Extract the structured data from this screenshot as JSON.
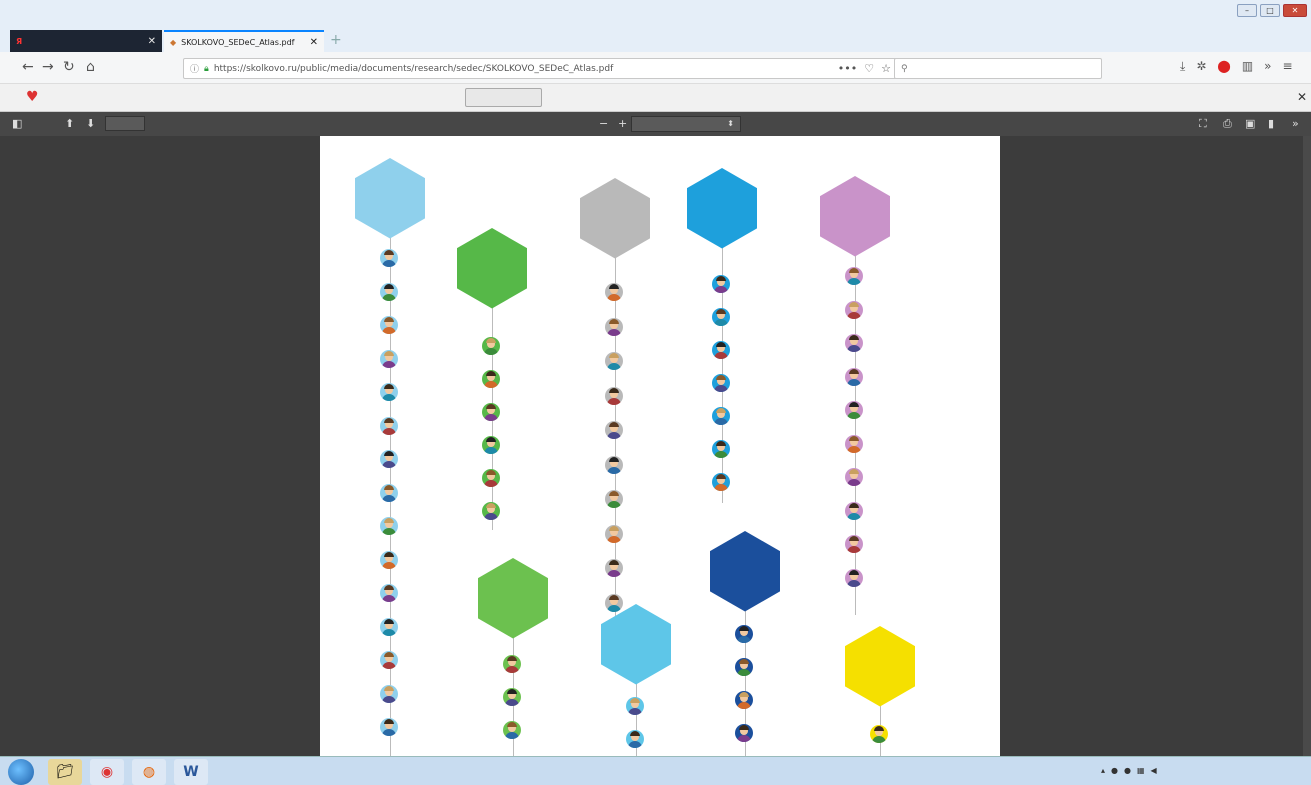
{
  "titlebar": {
    "menu": [
      "",
      "",
      "",
      "",
      "",
      "",
      ""
    ]
  },
  "tabs": [
    {
      "title": "",
      "active": false
    },
    {
      "title": "SKOLKOVO_SEDeC_Atlas.pdf",
      "active": true
    }
  ],
  "navbar": {
    "url": "https://skolkovo.ru/public/media/documents/research/sedec/SKOLKOVO_SEDeC_Atlas.pdf",
    "search_placeholder": ""
  },
  "notification": {
    "message": "",
    "button_label": "",
    "more_link": ""
  },
  "pdf_toolbar": {
    "current_page": "",
    "page_count": "",
    "zoom_label": ""
  },
  "atlas": {
    "columns": [
      {
        "title": "",
        "color": "#8fd0ec",
        "items": [
          {
            "label": ""
          },
          {
            "label": ""
          },
          {
            "label": ""
          },
          {
            "label": ""
          },
          {
            "label": ""
          },
          {
            "label": ""
          },
          {
            "label": ""
          },
          {
            "label": ""
          },
          {
            "label": ""
          },
          {
            "label": ""
          },
          {
            "label": ""
          },
          {
            "label": ""
          },
          {
            "label": ""
          },
          {
            "label": ""
          },
          {
            "label": ""
          }
        ]
      },
      {
        "title": "",
        "color": "#56b848",
        "items": [
          {
            "label": ""
          },
          {
            "label": ""
          },
          {
            "label": ""
          },
          {
            "label": ""
          },
          {
            "label": ""
          },
          {
            "label": ""
          }
        ]
      },
      {
        "title": "",
        "color": "#b9b9b9",
        "items": [
          {
            "label": ""
          },
          {
            "label": ""
          },
          {
            "label": ""
          },
          {
            "label": ""
          },
          {
            "label": ""
          },
          {
            "label": ""
          },
          {
            "label": ""
          },
          {
            "label": ""
          },
          {
            "label": ""
          },
          {
            "label": ""
          }
        ]
      },
      {
        "title": "",
        "color": "#1ea0dc",
        "items": [
          {
            "label": ""
          },
          {
            "label": ""
          },
          {
            "label": ""
          },
          {
            "label": ""
          },
          {
            "label": ""
          },
          {
            "label": ""
          },
          {
            "label": ""
          }
        ]
      },
      {
        "title": "",
        "color": "#c993c9",
        "items": [
          {
            "label": ""
          },
          {
            "label": ""
          },
          {
            "label": ""
          },
          {
            "label": ""
          },
          {
            "label": ""
          },
          {
            "label": ""
          },
          {
            "label": ""
          },
          {
            "label": ""
          },
          {
            "label": ""
          },
          {
            "label": ""
          }
        ]
      },
      {
        "title": "",
        "color": "#6cc14f",
        "items": [
          {
            "label": ""
          },
          {
            "label": ""
          },
          {
            "label": ""
          }
        ]
      },
      {
        "title": "",
        "color": "#5ec6e8",
        "items": [
          {
            "label": ""
          },
          {
            "label": ""
          }
        ]
      },
      {
        "title": "",
        "color": "#1b4f9c",
        "items": [
          {
            "label": ""
          },
          {
            "label": ""
          },
          {
            "label": ""
          },
          {
            "label": ""
          }
        ]
      },
      {
        "title": "",
        "color": "#f5e000",
        "items": [
          {
            "label": ""
          }
        ]
      }
    ]
  },
  "taskbar": {
    "clock_time": "",
    "clock_date": "",
    "lang": ""
  }
}
